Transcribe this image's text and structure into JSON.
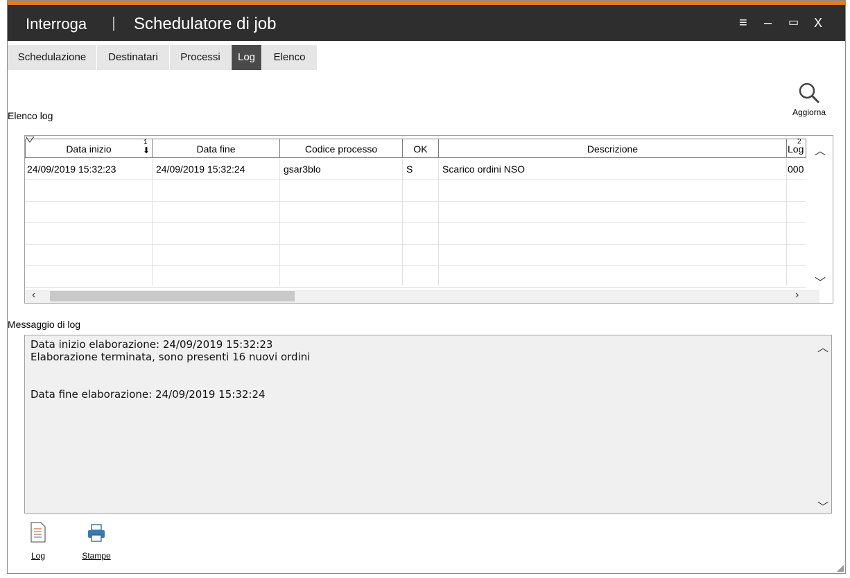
{
  "window": {
    "title_left": "Interroga",
    "title_sep": "|",
    "title_right": "Schedulatore di job",
    "controls": {
      "menu": "≡",
      "minimize": "–",
      "maximize": "▭",
      "close": "X"
    },
    "accent_color": "#ea7a1f"
  },
  "tabs": [
    {
      "label": "Schedulazione"
    },
    {
      "label": "Destinatari"
    },
    {
      "label": "Processi"
    },
    {
      "label": "Log",
      "active": true
    },
    {
      "label": "Elenco"
    }
  ],
  "toolbar": {
    "refresh_label": "Aggiorna",
    "refresh_icon": "search-icon"
  },
  "log_list": {
    "label": "Elenco log",
    "columns": [
      "Data inizio",
      "Data fine",
      "Codice processo",
      "OK",
      "Descrizione",
      "Log"
    ],
    "sort_markers": {
      "col0": "1",
      "col5": "2"
    },
    "rows": [
      [
        "24/09/2019 15:32:23",
        "24/09/2019 15:32:24",
        "gsar3blo",
        "S",
        "Scarico ordini NSO",
        "000"
      ]
    ]
  },
  "message": {
    "label": "Messaggio di log",
    "lines": [
      "Data inizio elaborazione: 24/09/2019 15:32:23",
      "Elaborazione terminata, sono presenti 16 nuovi ordini",
      "",
      "Data fine elaborazione: 24/09/2019 15:32:24"
    ]
  },
  "bottom_toolbar": [
    {
      "label": "Log",
      "icon": "document-icon"
    },
    {
      "label": "Stampe",
      "icon": "printer-icon"
    }
  ]
}
